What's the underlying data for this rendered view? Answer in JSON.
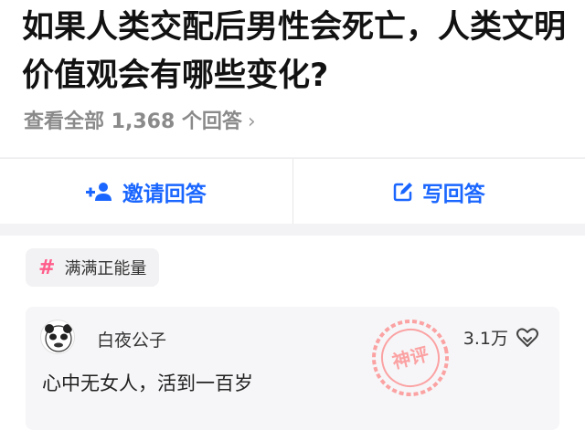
{
  "question": {
    "title": "如果人类交配后男性会死亡，人类文明价值观会有哪些变化?",
    "view_all": "查看全部 1,368 个回答"
  },
  "actions": {
    "invite_label": "邀请回答",
    "write_label": "写回答"
  },
  "answer": {
    "topic": "满满正能量",
    "comment": {
      "user": "白夜公子",
      "likes": "3.1万",
      "text": "心中无女人，活到一百岁",
      "badge": "神评"
    }
  },
  "colors": {
    "accent": "#1a66ff",
    "topic_hash": "#ff5c8a",
    "stamp": "#ff6b6b"
  },
  "icons": {
    "invite": "add-person-icon",
    "write": "edit-icon",
    "like": "heart-icon",
    "chevron": "chevron-right-icon"
  }
}
